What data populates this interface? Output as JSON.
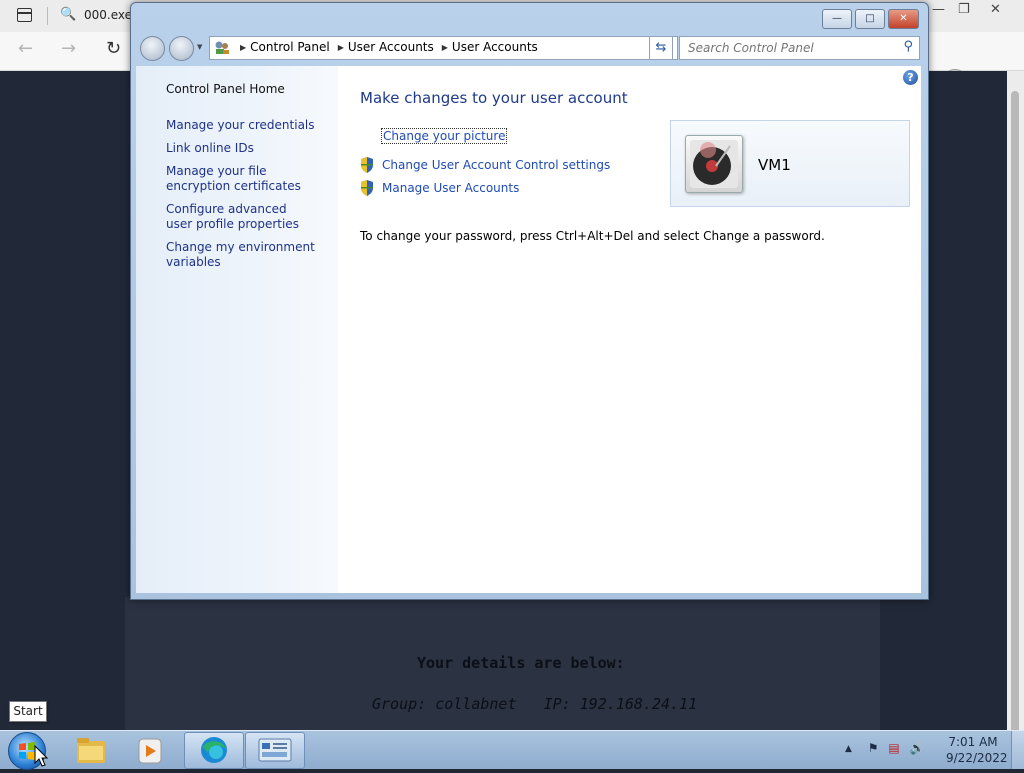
{
  "browser": {
    "tab_title": "000.exe",
    "page": {
      "details_heading": "Your details are below:",
      "details_line": "Group: collabnet   IP: 192.168.24.11"
    }
  },
  "window": {
    "address_crumbs": [
      "Control Panel",
      "User Accounts",
      "User Accounts"
    ],
    "search_placeholder": "Search Control Panel",
    "left_pane": {
      "home": "Control Panel Home",
      "links": [
        "Manage your credentials",
        "Link online IDs",
        "Manage your file encryption certificates",
        "Configure advanced user profile properties",
        "Change my environment variables"
      ]
    },
    "main": {
      "title": "Make changes to your user account",
      "tasks": {
        "change_picture": "Change your picture",
        "uac_settings": "Change User Account Control settings",
        "manage_accounts": "Manage User Accounts"
      },
      "user_name": "VM1",
      "password_note": "To change your password, press Ctrl+Alt+Del and select Change a password."
    },
    "help_label": "?"
  },
  "taskbar": {
    "start_tooltip": "Start",
    "clock_time": "7:01 AM",
    "clock_date": "9/22/2022"
  },
  "colors": {
    "link": "#1e3287",
    "task_link": "#1f4bb5",
    "title": "#1e3a8a"
  }
}
